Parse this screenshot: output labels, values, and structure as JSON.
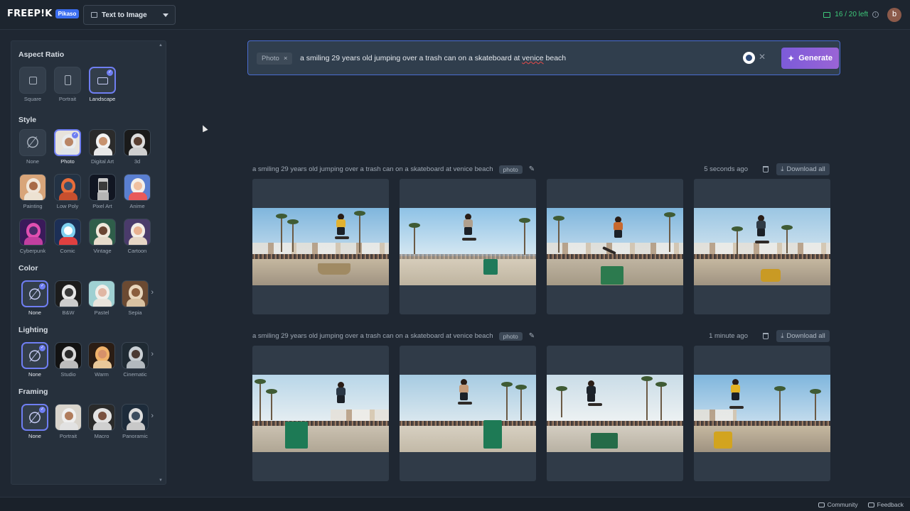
{
  "header": {
    "logo": "FREEP!K",
    "badge": "Pikaso",
    "mode": "Text to Image",
    "credits": "16 / 20 left",
    "avatar_letter": "b"
  },
  "sidebar": {
    "aspect_title": "Aspect Ratio",
    "aspect": [
      {
        "label": "Square",
        "selected": false
      },
      {
        "label": "Portrait",
        "selected": false
      },
      {
        "label": "Landscape",
        "selected": true
      }
    ],
    "style_title": "Style",
    "styles": [
      {
        "label": "None"
      },
      {
        "label": "Photo"
      },
      {
        "label": "Digital Art"
      },
      {
        "label": "3d"
      },
      {
        "label": "Painting"
      },
      {
        "label": "Low Poly"
      },
      {
        "label": "Pixel Art"
      },
      {
        "label": "Anime"
      },
      {
        "label": "Cyberpunk"
      },
      {
        "label": "Comic"
      },
      {
        "label": "Vintage"
      },
      {
        "label": "Cartoon"
      }
    ],
    "selected_style": "Photo",
    "color_title": "Color",
    "colors": [
      {
        "label": "None"
      },
      {
        "label": "B&W"
      },
      {
        "label": "Pastel"
      },
      {
        "label": "Sepia"
      }
    ],
    "lighting_title": "Lighting",
    "lighting": [
      {
        "label": "None"
      },
      {
        "label": "Studio"
      },
      {
        "label": "Warm"
      },
      {
        "label": "Cinematic"
      }
    ],
    "framing_title": "Framing",
    "framing": [
      {
        "label": "None"
      },
      {
        "label": "Portrait"
      },
      {
        "label": "Macro"
      },
      {
        "label": "Panoramic"
      }
    ]
  },
  "prompt": {
    "tag": "Photo",
    "text_before": "a smiling 29 years old jumping over a trash can on a skateboard at ",
    "text_misspelled": "venice",
    "text_after": " beach",
    "generate_label": "Generate"
  },
  "groups": [
    {
      "prompt": "a smiling 29 years old jumping over a trash can on a skateboard at venice beach",
      "chip": "photo",
      "time": "5 seconds ago",
      "download_label": "Download all"
    },
    {
      "prompt": "a smiling 29 years old jumping over a trash can on a skateboard at venice beach",
      "chip": "photo",
      "time": "1 minute ago",
      "download_label": "Download all"
    }
  ],
  "footer": {
    "community": "Community",
    "feedback": "Feedback"
  },
  "colors": {
    "accent": "#6f7ef2",
    "generate_start": "#7c5bd9",
    "generate_end": "#9a64d6",
    "credits_green": "#3ec97a"
  }
}
